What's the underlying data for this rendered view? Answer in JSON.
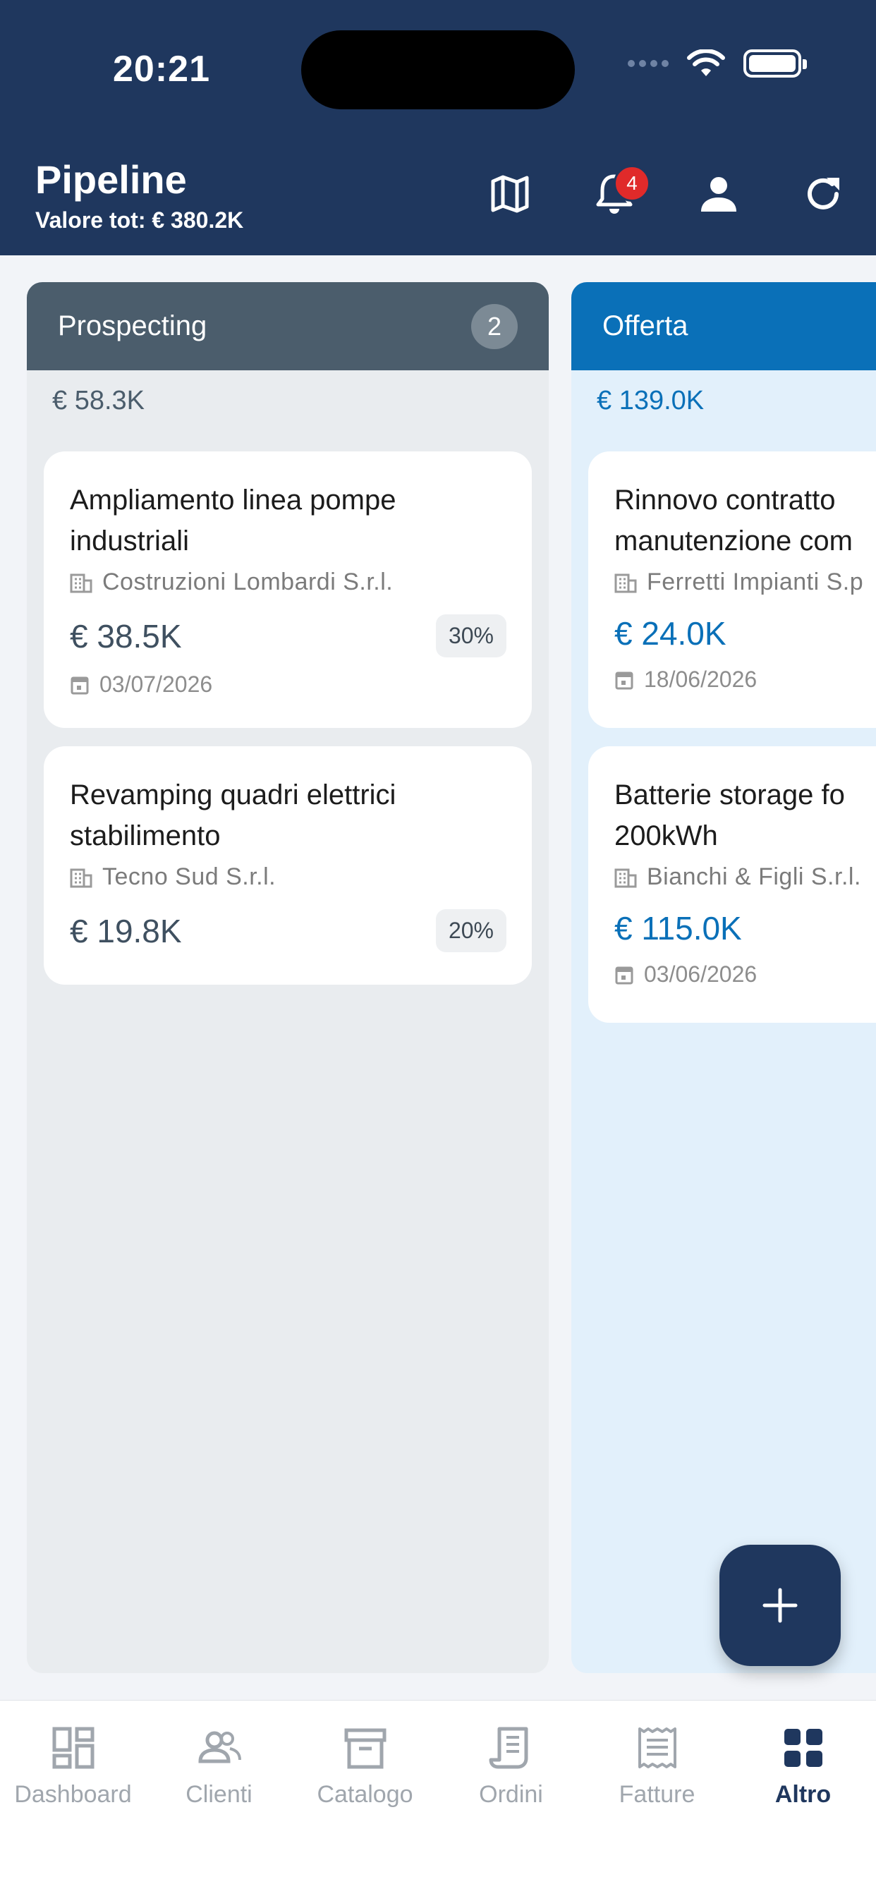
{
  "status_bar": {
    "time": "20:21"
  },
  "header": {
    "title": "Pipeline",
    "subtitle": "Valore tot: € 380.2K",
    "notification_count": "4"
  },
  "columns": [
    {
      "name": "Prospecting",
      "count": "2",
      "total": "€ 58.3K",
      "cards": [
        {
          "title": "Ampliamento linea pompe industriali",
          "client": "Costruzioni Lombardi S.r.l.",
          "amount": "€ 38.5K",
          "probability": "30%",
          "date": "03/07/2026"
        },
        {
          "title": "Revamping quadri elettrici stabilimento",
          "client": "Tecno Sud S.r.l.",
          "amount": "€ 19.8K",
          "probability": "20%"
        }
      ]
    },
    {
      "name": "Offerta",
      "total": "€ 139.0K",
      "cards": [
        {
          "title": "Rinnovo contratto manutenzione com",
          "client": "Ferretti Impianti S.p",
          "amount": "€ 24.0K",
          "date": "18/06/2026"
        },
        {
          "title": "Batterie storage fo 200kWh",
          "client": "Bianchi & Figli S.r.l.",
          "amount": "€ 115.0K",
          "date": "03/06/2026"
        }
      ]
    }
  ],
  "fab": {
    "icon": "plus-icon"
  },
  "bottom_nav": [
    {
      "label": "Dashboard",
      "icon": "dashboard-icon"
    },
    {
      "label": "Clienti",
      "icon": "people-icon"
    },
    {
      "label": "Catalogo",
      "icon": "archive-icon"
    },
    {
      "label": "Ordini",
      "icon": "receipt-icon"
    },
    {
      "label": "Fatture",
      "icon": "invoice-icon"
    },
    {
      "label": "Altro",
      "icon": "grid-icon",
      "active": true
    }
  ],
  "colors": {
    "header": "#1f375e",
    "offerta": "#0a70b8",
    "prospecting": "#4b5d6c",
    "badge": "#e02a2a"
  }
}
